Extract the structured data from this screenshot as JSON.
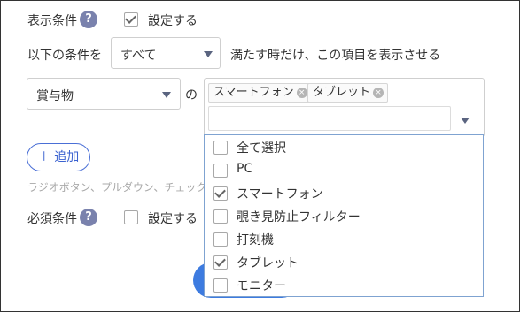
{
  "display_condition": {
    "label": "表示条件",
    "help": "?",
    "checkbox_label": "設定する",
    "checked": true
  },
  "condition_row": {
    "prefix": "以下の条件を",
    "match_select": "すべて",
    "suffix": "満たす時だけ、この項目を表示させる"
  },
  "field_row": {
    "field_select": "賞与物",
    "connector": "の",
    "selected_tags": [
      "スマートフォン",
      "タブレット"
    ],
    "tag_remove_glyph": "×"
  },
  "dropdown": {
    "options": [
      {
        "label": "全て選択",
        "checked": false
      },
      {
        "label": "PC",
        "checked": false
      },
      {
        "label": "スマートフォン",
        "checked": true
      },
      {
        "label": "覗き見防止フィルター",
        "checked": false
      },
      {
        "label": "打刻機",
        "checked": false
      },
      {
        "label": "タブレット",
        "checked": true
      },
      {
        "label": "モニター",
        "checked": false
      }
    ]
  },
  "add_button": {
    "label": "＋ 追加"
  },
  "hint_text": "ラジオボタン、プルダウン、チェック",
  "required_condition": {
    "label": "必須条件",
    "help": "?",
    "checkbox_label": "設定する",
    "checked": false
  },
  "colors": {
    "help_badge": "#7a82ad",
    "accent_blue": "#3b62d0",
    "dropdown_border": "#7fa3d1",
    "primary_button": "#3d7be0"
  }
}
